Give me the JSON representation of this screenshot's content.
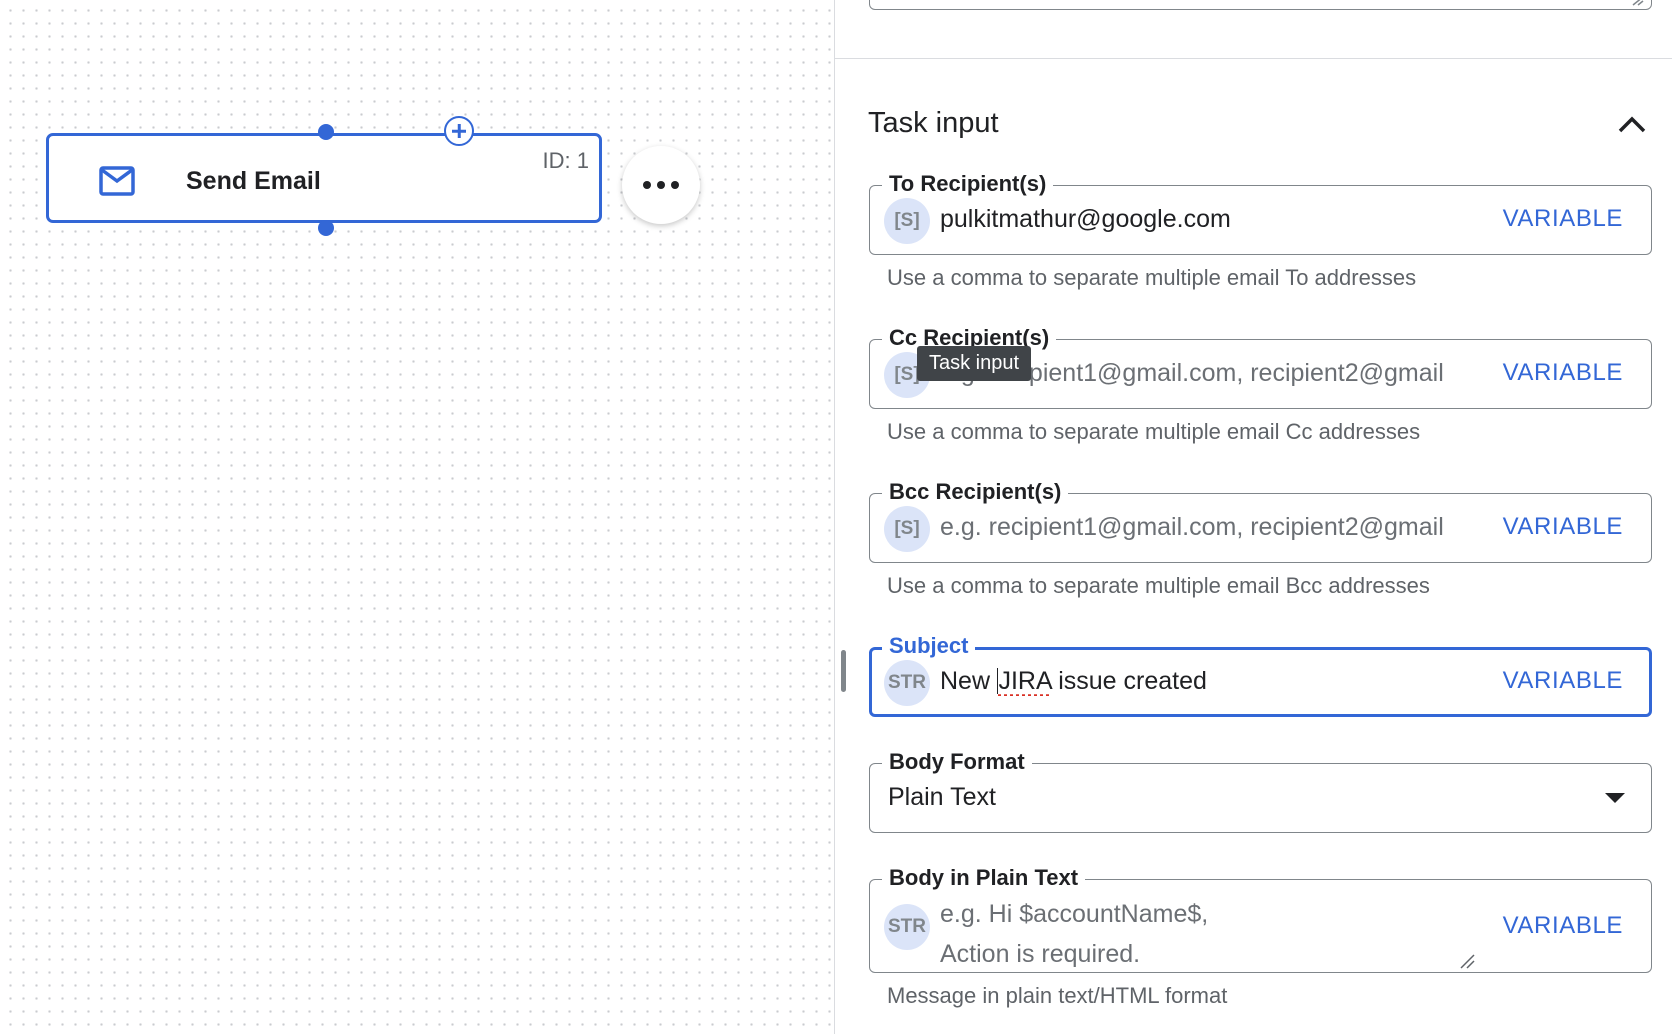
{
  "canvas": {
    "node": {
      "title": "Send Email",
      "id_label": "ID: 1",
      "icon": "mail-icon"
    },
    "more_button_icon": "more-horiz-icon"
  },
  "panel": {
    "section_title": "Task input",
    "fields": {
      "to": {
        "label": "To Recipient(s)",
        "type_badge": "[S]",
        "value": "pulkitmathur@google.com",
        "variable_label": "VARIABLE",
        "helper": "Use a comma to separate multiple email To addresses"
      },
      "cc": {
        "label": "Cc Recipient(s)",
        "type_badge": "[S]",
        "placeholder": "e.g. recipient1@gmail.com, recipient2@gmail",
        "variable_label": "VARIABLE",
        "helper": "Use a comma to separate multiple email Cc addresses"
      },
      "bcc": {
        "label": "Bcc Recipient(s)",
        "type_badge": "[S]",
        "placeholder": "e.g. recipient1@gmail.com, recipient2@gmail",
        "variable_label": "VARIABLE",
        "helper": "Use a comma to separate multiple email Bcc addresses"
      },
      "subject": {
        "label": "Subject",
        "type_badge": "STR",
        "value_prefix": "New ",
        "value_flagged": "JIRA",
        "value_suffix": " issue created",
        "variable_label": "VARIABLE"
      },
      "body_format": {
        "label": "Body Format",
        "selected": "Plain Text"
      },
      "body": {
        "label": "Body in Plain Text",
        "type_badge": "STR",
        "placeholder_line1": "e.g. Hi $accountName$,",
        "placeholder_line2": "Action is required.",
        "variable_label": "VARIABLE",
        "helper": "Message in plain text/HTML format"
      }
    },
    "tooltip": "Task input"
  },
  "colors": {
    "accent": "#3367d6",
    "badge_bg": "#dbe4f8",
    "outline": "#80868b",
    "helper_text": "#5f6368"
  }
}
